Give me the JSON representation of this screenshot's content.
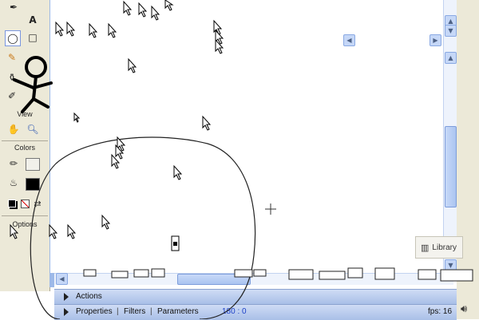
{
  "toolbar": {
    "view_label": "View",
    "colors_label": "Colors",
    "options_label": "Options",
    "text_tool_glyph": "A"
  },
  "panels": {
    "actions_label": "Actions",
    "properties_label": "Properties",
    "filters_label": "Filters",
    "parameters_label": "Parameters",
    "separator": "|",
    "coords": "180 : 0"
  },
  "status": {
    "fps": "fps: 16"
  },
  "library": {
    "label": "Library"
  },
  "icons": {
    "scroll_up": "up-arrow",
    "scroll_down": "down-arrow",
    "scroll_left": "left-arrow",
    "scroll_right": "right-arrow"
  }
}
